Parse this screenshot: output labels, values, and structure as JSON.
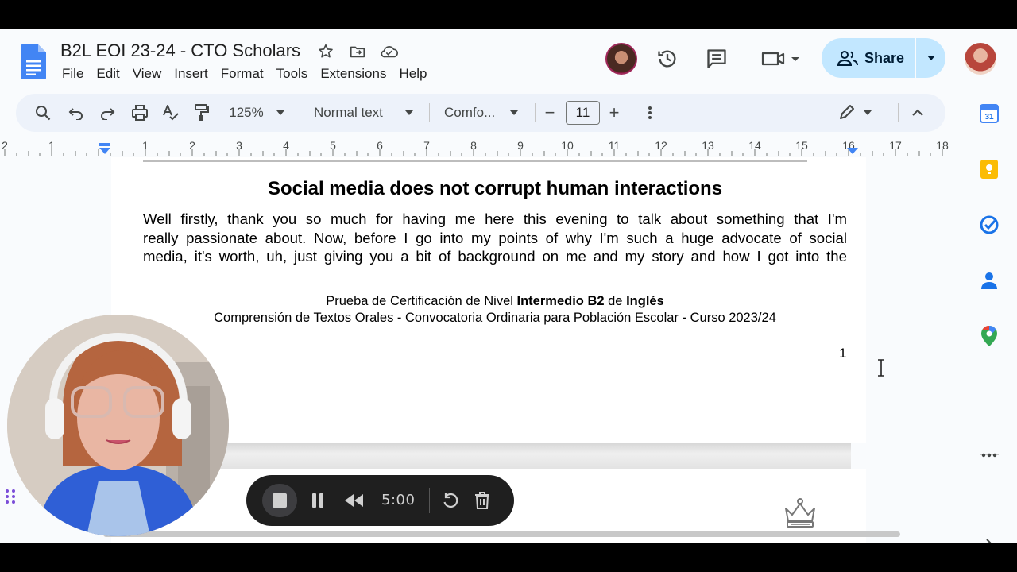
{
  "doc": {
    "title": "B2L EOI 23-24 - CTO Scholars"
  },
  "menu": [
    "File",
    "Edit",
    "View",
    "Insert",
    "Format",
    "Tools",
    "Extensions",
    "Help"
  ],
  "header": {
    "share_label": "Share"
  },
  "toolbar": {
    "zoom": "125%",
    "style": "Normal text",
    "font": "Comfo...",
    "font_size": "11",
    "minus": "−",
    "plus": "+"
  },
  "ruler": {
    "labels": [
      "2",
      "1",
      "1",
      "2",
      "3",
      "4",
      "5",
      "6",
      "7",
      "8",
      "9",
      "10",
      "11",
      "12",
      "13",
      "14",
      "15",
      "16",
      "17",
      "18"
    ]
  },
  "content": {
    "heading": "Social media does not corrupt human interactions",
    "paragraph_lines": [
      "Well firstly, thank you so much for having me here this evening to talk about something that I'm",
      "really passionate about. Now, before I go into my points of why I'm such a huge advocate of social",
      "media, it's worth, uh, just giving you a bit of background on me and my story and how I got into the"
    ],
    "footer_line1_parts": [
      "Prueba de Certificación de Nivel ",
      "Intermedio B2",
      " de ",
      "Inglés"
    ],
    "footer_line2": "Comprensión de Textos Orales - Convocatoria Ordinaria para Población Escolar - Curso 2023/24",
    "page_number": "1"
  },
  "recorder": {
    "time": "5:00"
  },
  "icons": {
    "title": [
      "star-icon",
      "move-folder-icon",
      "cloud-saved-icon"
    ],
    "header": [
      "version-history-icon",
      "comments-icon",
      "meet-icon"
    ],
    "toolbar": [
      "search-icon",
      "undo-icon",
      "redo-icon",
      "print-icon",
      "spellcheck-icon",
      "paint-format-icon",
      "more-icon",
      "editing-mode-icon",
      "collapse-icon"
    ],
    "side": [
      "calendar-icon",
      "keep-icon",
      "tasks-icon",
      "contacts-icon",
      "maps-icon",
      "more-apps-icon",
      "expand-panel-icon"
    ],
    "recorder": [
      "stop-icon",
      "pause-icon",
      "rewind-icon",
      "restart-icon",
      "delete-icon"
    ]
  },
  "colors": {
    "docs_blue": "#4285f4",
    "share_bg": "#c2e7ff",
    "toolbar_bg": "#edf2fa",
    "recorder_bg": "#1f1f1f"
  }
}
